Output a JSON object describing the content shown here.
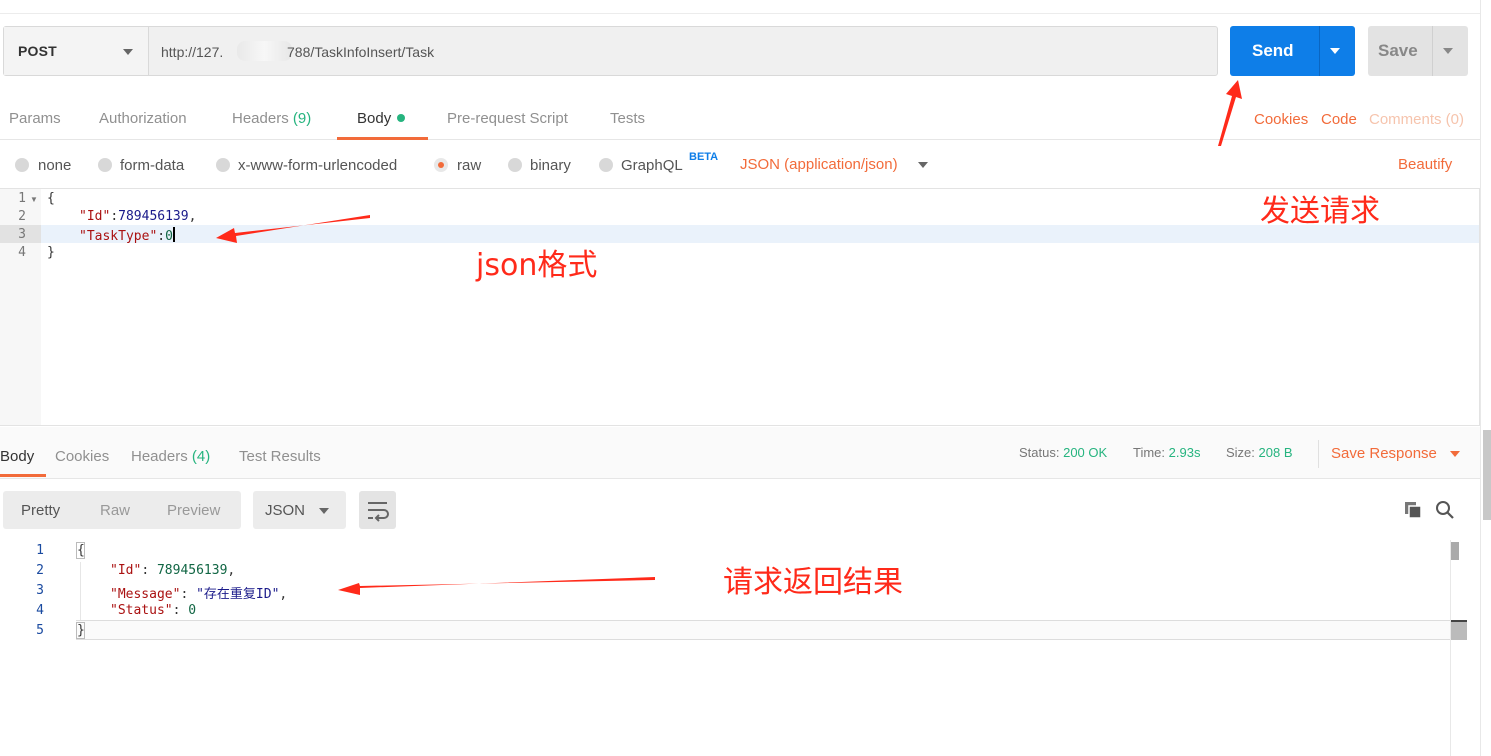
{
  "request": {
    "method": "POST",
    "url_prefix": "http://127.",
    "url_suffix": "788/TaskInfoInsert/Task",
    "send_label": "Send",
    "save_label": "Save"
  },
  "request_tabs": [
    {
      "label": "Params"
    },
    {
      "label": "Authorization"
    },
    {
      "label": "Headers",
      "count": "(9)"
    },
    {
      "label": "Body",
      "active": true
    },
    {
      "label": "Pre-request Script"
    },
    {
      "label": "Tests"
    }
  ],
  "right_links": {
    "cookies": "Cookies",
    "code": "Code",
    "comments": "Comments (0)"
  },
  "body_types": {
    "none": "none",
    "form_data": "form-data",
    "urlencoded": "x-www-form-urlencoded",
    "raw": "raw",
    "binary": "binary",
    "graphql": "GraphQL",
    "beta": "BETA",
    "selected_format": "JSON (application/json)",
    "beautify": "Beautify"
  },
  "request_body": {
    "line_numbers": [
      "1",
      "2",
      "3",
      "4"
    ],
    "open": "{",
    "id_key": "\"Id\"",
    "id_val": "789456139",
    "tasktype_key": "\"TaskType\"",
    "tasktype_val": "0",
    "close": "}"
  },
  "response_tabs": {
    "body": "Body",
    "cookies": "Cookies",
    "headers": "Headers",
    "headers_count": "(4)",
    "test_results": "Test Results"
  },
  "response_status": {
    "status_label": "Status:",
    "status_value": "200 OK",
    "time_label": "Time:",
    "time_value": "2.93s",
    "size_label": "Size:",
    "size_value": "208 B",
    "save_response": "Save Response"
  },
  "response_view": {
    "pretty": "Pretty",
    "raw": "Raw",
    "preview": "Preview",
    "format": "JSON"
  },
  "response_body": {
    "line_numbers": [
      "1",
      "2",
      "3",
      "4",
      "5"
    ],
    "open": "{",
    "id_key": "\"Id\"",
    "id_val": "789456139",
    "message_key": "\"Message\"",
    "message_val": "\"存在重复ID\"",
    "status_key": "\"Status\"",
    "status_val": "0",
    "close": "}"
  },
  "annotations": {
    "send_note": "发送请求",
    "json_note": "json格式",
    "result_note": "请求返回结果"
  },
  "colors": {
    "send_button": "#0e7ee8",
    "accent_orange": "#f26b3a",
    "status_green": "#26b47f",
    "annotation_red": "#ff2a1a"
  }
}
